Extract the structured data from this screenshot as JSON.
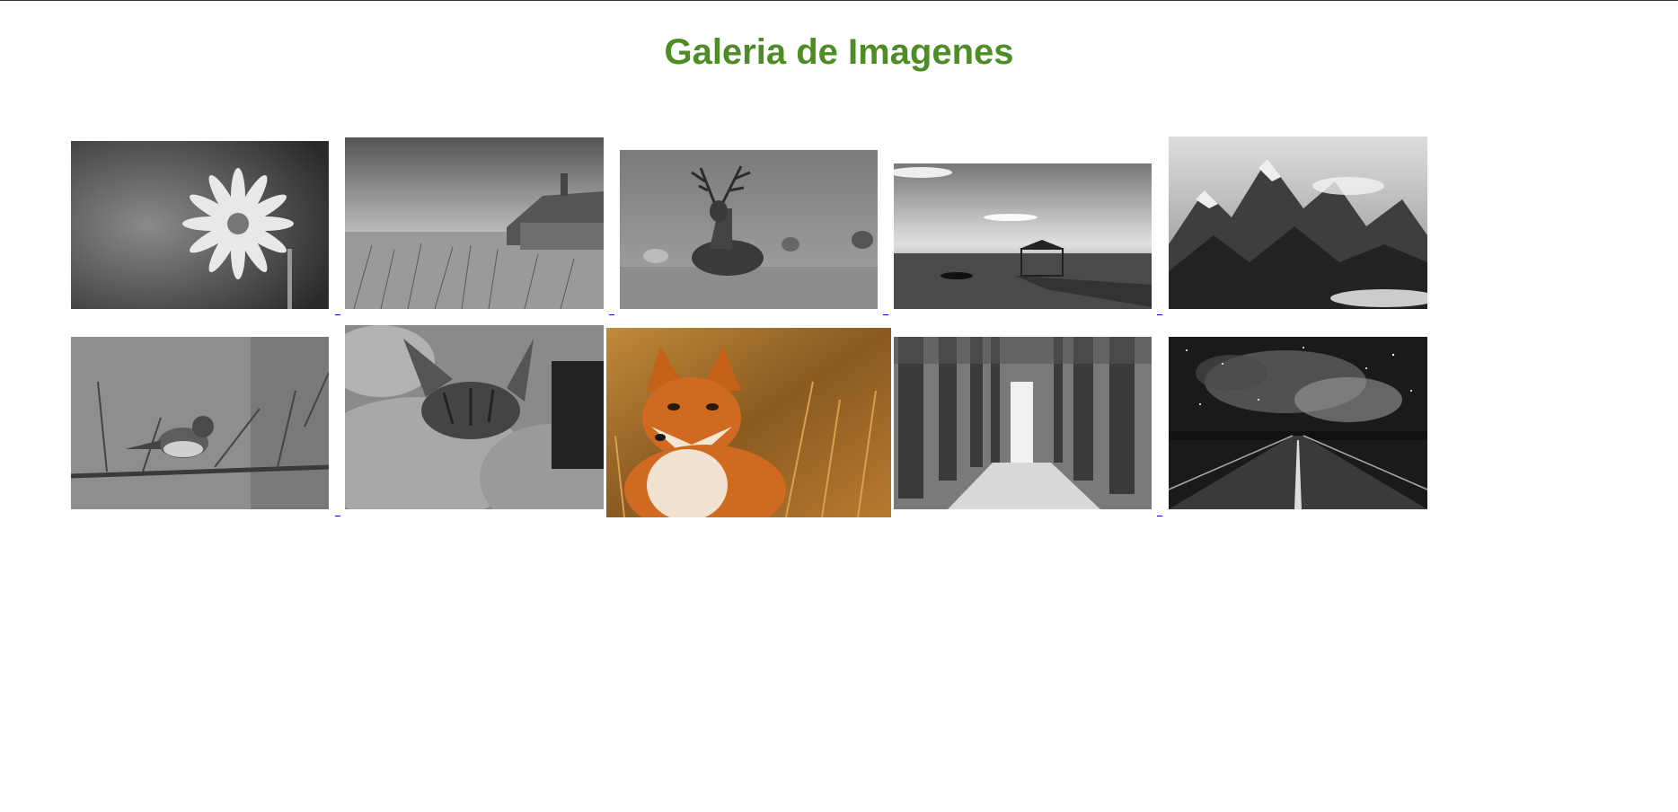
{
  "page": {
    "title": "Galeria de Imagenes"
  },
  "colors": {
    "title": "#4e8c26",
    "link": "#0000cc"
  },
  "gallery": {
    "images": [
      {
        "name": "daisy-photo",
        "subject": "daisy flower",
        "grayscale": true
      },
      {
        "name": "beach-house-photo",
        "subject": "thatched house on dunes",
        "grayscale": true
      },
      {
        "name": "deer-photo",
        "subject": "deer in field",
        "grayscale": true
      },
      {
        "name": "pier-photo",
        "subject": "pier with gazebo on water",
        "grayscale": true
      },
      {
        "name": "mountains-photo",
        "subject": "snowy mountain peaks",
        "grayscale": true
      },
      {
        "name": "bird-photo",
        "subject": "sparrow on branch",
        "grayscale": true
      },
      {
        "name": "cat-photo",
        "subject": "sleeping tabby cat",
        "grayscale": true
      },
      {
        "name": "fox-photo",
        "subject": "red fox in grass",
        "grayscale": false
      },
      {
        "name": "forest-path-photo",
        "subject": "tree lined forest path",
        "grayscale": true
      },
      {
        "name": "road-galaxy-photo",
        "subject": "road under starry sky",
        "grayscale": true
      }
    ]
  }
}
